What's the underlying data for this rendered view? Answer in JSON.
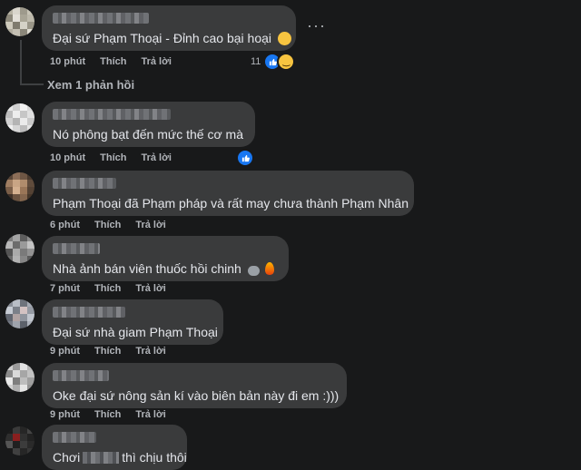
{
  "comments": [
    {
      "text": "Đại sứ Phạm Thoại - Đỉnh cao bại hoại",
      "time": "10 phút",
      "like_label": "Thích",
      "reply_label": "Trả lời",
      "reaction_count": "11"
    },
    {
      "text": "Nó phông bạt đến mức thế cơ mà",
      "time": "10 phút",
      "like_label": "Thích",
      "reply_label": "Trả lời"
    },
    {
      "text": "Phạm Thoại đã Phạm pháp và rất may chưa thành Phạm Nhân",
      "time": "6 phút",
      "like_label": "Thích",
      "reply_label": "Trả lời"
    },
    {
      "text": "Nhà ảnh bán viên thuốc hồi chinh",
      "time": "7 phút",
      "like_label": "Thích",
      "reply_label": "Trả lời"
    },
    {
      "text": "Đại sứ nhà giam Phạm Thoại",
      "time": "9 phút",
      "like_label": "Thích",
      "reply_label": "Trả lời"
    },
    {
      "text": "Oke đại sứ nông sản kí vào biên bản này đi em :)))",
      "time": "9 phút",
      "like_label": "Thích",
      "reply_label": "Trả lời"
    },
    {
      "text_before": "Chơi",
      "text_after": "thì chịu thôi"
    }
  ],
  "view_replies": "Xem 1 phản hồi",
  "more_options": "···"
}
